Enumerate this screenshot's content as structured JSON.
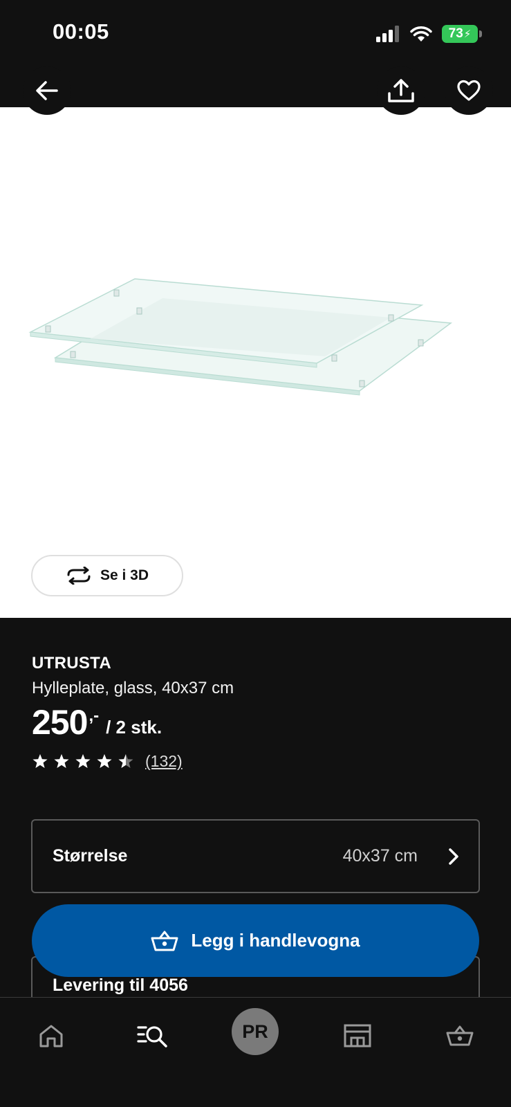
{
  "status_bar": {
    "time": "00:05",
    "battery": "73"
  },
  "product": {
    "brand": "UTRUSTA",
    "description": "Hylleplate, glass, 40x37 cm",
    "price": "250",
    "price_suffix": ",-",
    "price_unit": "/ 2 stk.",
    "rating": 4.5,
    "review_count": "(132)",
    "view_3d_label": "Se i 3D"
  },
  "size_selector": {
    "label": "Størrelse",
    "value": "40x37 cm"
  },
  "add_to_cart_label": "Legg i handlevogna",
  "delivery": {
    "label": "Levering til 4056"
  },
  "tab_bar": {
    "avatar_initials": "PR"
  },
  "colors": {
    "accent_blue": "#0058a3",
    "background": "#111111",
    "battery_green": "#34c759"
  }
}
